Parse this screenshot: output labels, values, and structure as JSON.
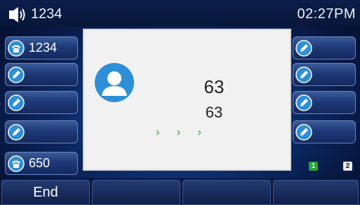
{
  "statusbar": {
    "line_icon": "speaker-icon",
    "line_label": "1234",
    "time": "02:27PM"
  },
  "left_keys": [
    {
      "icon": "phone-line-icon",
      "label": "1234"
    },
    {
      "icon": "edit-icon",
      "label": ""
    },
    {
      "icon": "edit-icon",
      "label": ""
    },
    {
      "icon": "edit-icon",
      "label": ""
    },
    {
      "icon": "phone-line-icon",
      "label": "650"
    }
  ],
  "right_keys": [
    {
      "icon": "edit-icon"
    },
    {
      "icon": "edit-icon"
    },
    {
      "icon": "edit-icon"
    },
    {
      "icon": "edit-icon"
    }
  ],
  "call": {
    "name": "63",
    "number": "63",
    "progress_arrows": [
      "›",
      "›",
      "›"
    ],
    "avatar": "contact-avatar-icon"
  },
  "page_indicators": {
    "page1": "1",
    "page2": "2"
  },
  "softkeys": [
    "End",
    "",
    "",
    ""
  ],
  "colors": {
    "accent_green": "#3aa845",
    "dialog_bg": "#f1f1f1",
    "avatar_blue": "#2e8fd8"
  }
}
